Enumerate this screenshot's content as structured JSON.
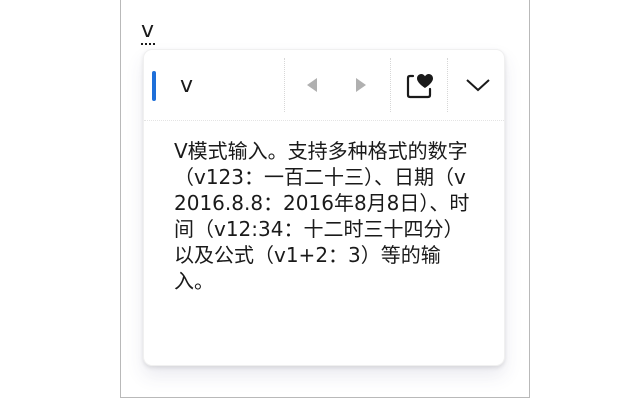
{
  "composition": {
    "text": "v"
  },
  "ime_panel": {
    "input_text": "v",
    "prev_icon": "triangle-left-icon",
    "next_icon": "triangle-right-icon",
    "favorite_icon": "heart-box-icon",
    "expand_icon": "chevron-down-icon",
    "description": "V模式输入。支持多种格式的数字（v123：一百二十三）、日期（v2016.8.8：2016年8月8日）、时间（v12:34：十二时三十四分）以及公式（v1+2：3）等的输入。"
  },
  "colors": {
    "accent": "#1e6fd9",
    "disabled_arrow": "#b0b0b0",
    "text": "#1a1a1a"
  }
}
